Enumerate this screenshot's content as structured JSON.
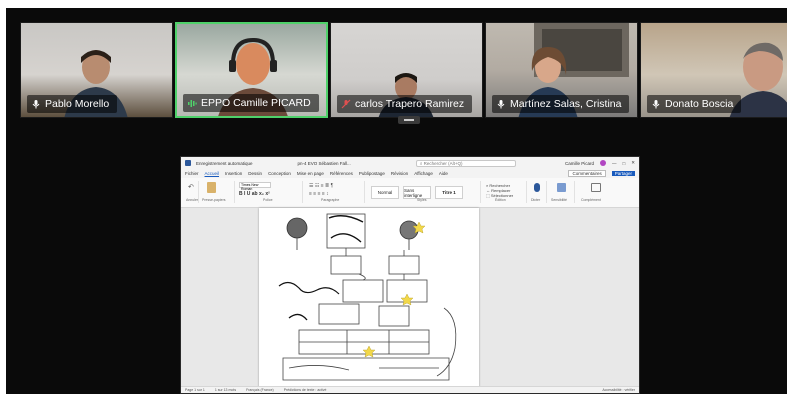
{
  "participants": [
    {
      "name": "Pablo Morello",
      "mic": "mic-icon",
      "active": false
    },
    {
      "name": "EPPO Camille PICARD",
      "mic": "audio-level-icon",
      "active": true
    },
    {
      "name": "carlos Trapero Ramirez",
      "mic": "mic-muted-icon",
      "active": false
    },
    {
      "name": "Martínez Salas, Cristina",
      "mic": "mic-icon",
      "active": false
    },
    {
      "name": "Donato Boscia",
      "mic": "mic-icon",
      "active": false
    }
  ],
  "shared_screen": {
    "title_left": "Enregistrement automatique",
    "doc_title": "pn-4 EVO Sébastien Fall...",
    "search_placeholder": "Rechercher (Alt+Q)",
    "user": "Camille Picard",
    "menu": [
      "Fichier",
      "Accueil",
      "Insertion",
      "Dessin",
      "Conception",
      "Mise en page",
      "Références",
      "Publipostage",
      "Révision",
      "Affichage",
      "Aide"
    ],
    "selected_menu": "Accueil",
    "comments_label": "Commentaires",
    "share_label": "Partager",
    "styles": [
      "Normal",
      "Sans interligne",
      "Titre 1"
    ],
    "font_name": "Times New Roman",
    "ribbon_groups": [
      "Annuler",
      "Presse-papiers",
      "Police",
      "Paragraphe",
      "Styles",
      "Édition",
      "Dicter",
      "Sensibilité",
      "Complément"
    ],
    "status_items": [
      "Page 1 sur 1",
      "1 sur 13 mots",
      "Français (France)",
      "Prédictions de texte : activé",
      "Accessibilité : vérifier"
    ]
  },
  "colors": {
    "active_speaker": "#4fd16a",
    "word_blue": "#185abd"
  }
}
